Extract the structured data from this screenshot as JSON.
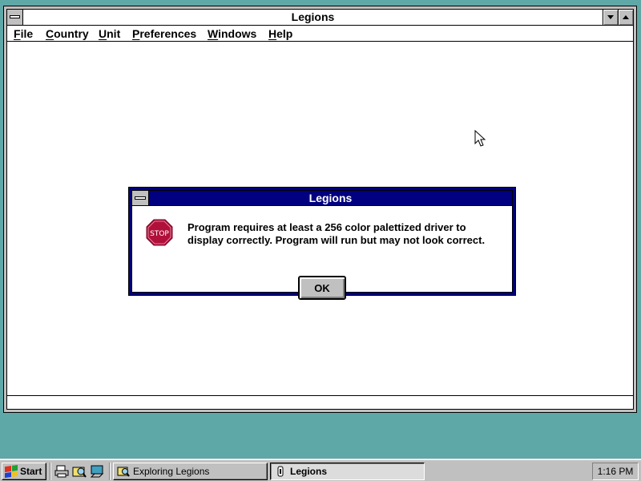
{
  "window": {
    "title": "Legions",
    "menu": [
      {
        "label": "File",
        "accel": "F",
        "rest": "ile"
      },
      {
        "label": "Country",
        "accel": "C",
        "rest": "ountry"
      },
      {
        "label": "Unit",
        "accel": "U",
        "rest": "nit"
      },
      {
        "label": "Preferences",
        "accel": "P",
        "rest": "references"
      },
      {
        "label": "Windows",
        "accel": "W",
        "rest": "indows"
      },
      {
        "label": "Help",
        "accel": "H",
        "rest": "elp"
      }
    ]
  },
  "dialog": {
    "title": "Legions",
    "icon": "stop-sign-icon",
    "icon_text": "STOP",
    "message_line1": "Program requires at least a 256 color palettized driver to",
    "message_line2": "display correctly.  Program will run but may not look correct.",
    "ok_label": "OK"
  },
  "taskbar": {
    "start_label": "Start",
    "quick_launch": [
      "printer-icon",
      "explorer-icon",
      "desktop-icon"
    ],
    "tasks": [
      {
        "label": "Exploring Legions",
        "icon": "explorer-folder-icon",
        "active": false
      },
      {
        "label": "Legions",
        "icon": "legions-app-icon",
        "active": true
      }
    ],
    "clock": "1:16 PM"
  },
  "colors": {
    "desktop": "#5fa8a8",
    "dialog_frame": "#000080",
    "face": "#c0c0c0",
    "stop_red": "#b0103a"
  }
}
